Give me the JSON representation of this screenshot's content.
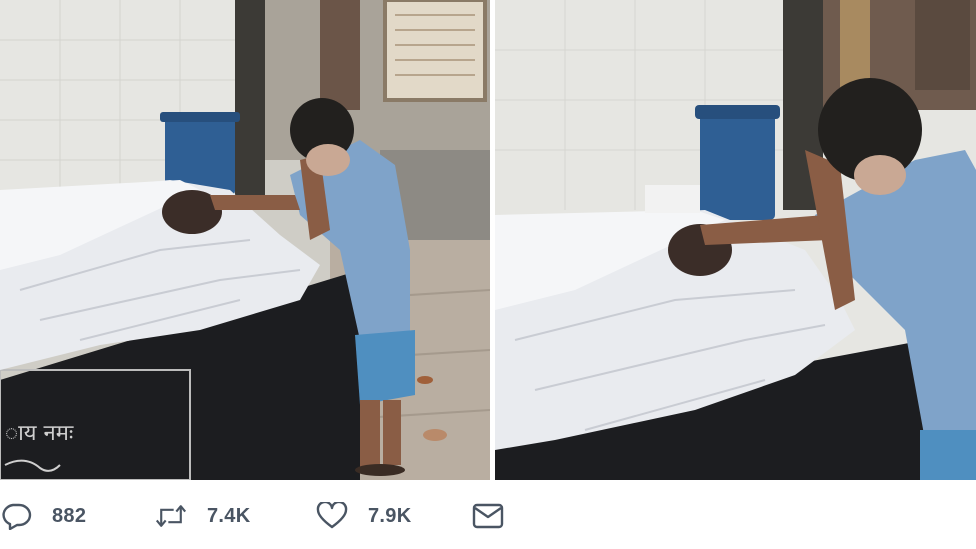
{
  "tweet_actions": {
    "replies": {
      "icon": "reply-icon",
      "count": "882"
    },
    "retweets": {
      "icon": "retweet-icon",
      "count": "7.4K"
    },
    "likes": {
      "icon": "heart-icon",
      "count": "7.9K"
    },
    "message": {
      "icon": "envelope-icon"
    }
  },
  "photos": {
    "left": {
      "tablet_text": "ाय नमः"
    }
  },
  "colors": {
    "action_gray": "#4a5563",
    "shirt_blue": "#7fa3c9",
    "shorts_blue": "#4f8fc0",
    "bin_blue": "#2f5f94",
    "sheet_white": "#e9ebef",
    "slab_black": "#1c1d20"
  }
}
